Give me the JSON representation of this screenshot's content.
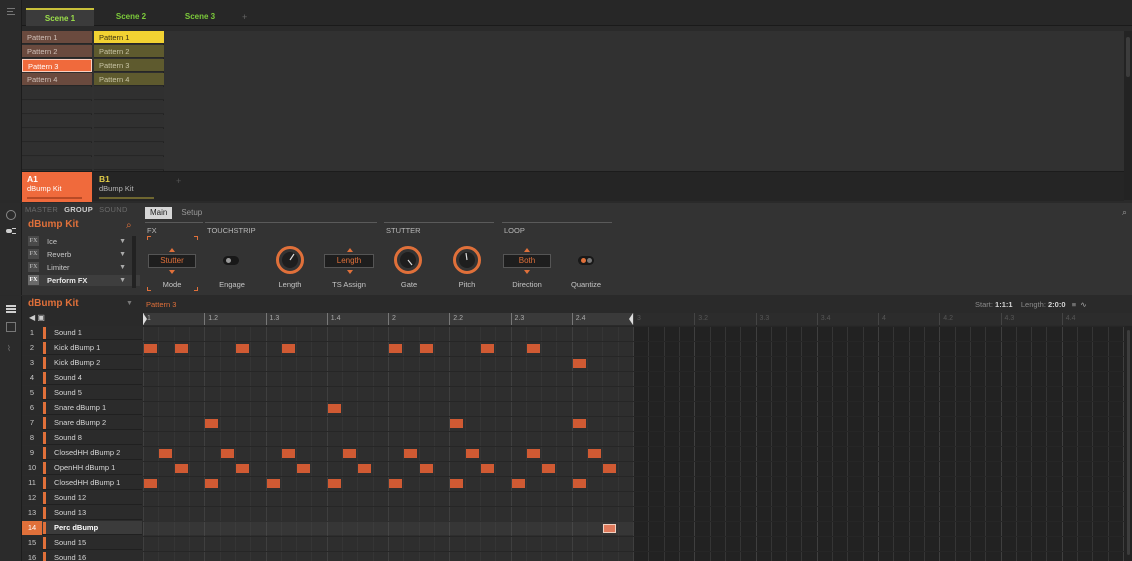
{
  "scenes": {
    "tabs": [
      "Scene 1",
      "Scene 2",
      "Scene 3"
    ],
    "add_label": "+"
  },
  "patterns": {
    "col_a": [
      "Pattern 1",
      "Pattern 2",
      "Pattern 3",
      "Pattern 4"
    ],
    "col_b": [
      "Pattern 1",
      "Pattern 2",
      "Pattern 3",
      "Pattern 4"
    ]
  },
  "groups": [
    {
      "letter": "A1",
      "kit": "dBump Kit"
    },
    {
      "letter": "B1",
      "kit": "dBump Kit"
    }
  ],
  "group_add": "+",
  "panel": {
    "tabs": [
      "MASTER",
      "GROUP",
      "SOUND"
    ],
    "kit_name": "dBump Kit",
    "fx_slots": [
      {
        "badge": "FX",
        "name": "Ice"
      },
      {
        "badge": "FX",
        "name": "Reverb"
      },
      {
        "badge": "FX",
        "name": "Limiter"
      },
      {
        "badge": "FX",
        "name": "Perform FX"
      }
    ],
    "main_tabs": [
      "Main",
      "Setup"
    ],
    "sections": [
      "FX",
      "TOUCHSTRIP",
      "STUTTER",
      "LOOP"
    ],
    "controls": {
      "mode": {
        "label": "Mode",
        "value": "Stutter"
      },
      "engage": {
        "label": "Engage"
      },
      "length": {
        "label": "Length"
      },
      "ts_assign": {
        "label": "TS Assign",
        "value": "Length"
      },
      "gate": {
        "label": "Gate"
      },
      "pitch": {
        "label": "Pitch"
      },
      "direction": {
        "label": "Direction",
        "value": "Both"
      },
      "quantize": {
        "label": "Quantize"
      }
    }
  },
  "editor": {
    "kit_name": "dBump Kit",
    "pattern_name": "Pattern 3",
    "start_label": "Start:",
    "start_value": "1:1:1",
    "length_label": "Length:",
    "length_value": "2:0:0",
    "ruler": [
      "1",
      "1.2",
      "1.3",
      "1.4",
      "2",
      "2.2",
      "2.3",
      "2.4",
      "3",
      "3.2",
      "3.3",
      "3.4",
      "4",
      "4.2",
      "4.3",
      "4.4"
    ],
    "sounds": [
      {
        "num": "1",
        "name": "Sound 1"
      },
      {
        "num": "2",
        "name": "Kick dBump 1"
      },
      {
        "num": "3",
        "name": "Kick dBump 2"
      },
      {
        "num": "4",
        "name": "Sound 4"
      },
      {
        "num": "5",
        "name": "Sound 5"
      },
      {
        "num": "6",
        "name": "Snare dBump 1"
      },
      {
        "num": "7",
        "name": "Snare dBump 2"
      },
      {
        "num": "8",
        "name": "Sound 8"
      },
      {
        "num": "9",
        "name": "ClosedHH dBump 2"
      },
      {
        "num": "10",
        "name": "OpenHH dBump 1"
      },
      {
        "num": "11",
        "name": "ClosedHH dBump 1"
      },
      {
        "num": "12",
        "name": "Sound 12"
      },
      {
        "num": "13",
        "name": "Sound 13"
      },
      {
        "num": "14",
        "name": "Perc dBump"
      },
      {
        "num": "15",
        "name": "Sound 15"
      },
      {
        "num": "16",
        "name": "Sound 16"
      }
    ],
    "selected_sound": 13,
    "notes": [
      {
        "row": 1,
        "steps": [
          0,
          2,
          6,
          9,
          16,
          18,
          22,
          25
        ]
      },
      {
        "row": 2,
        "steps": [
          28
        ]
      },
      {
        "row": 5,
        "steps": [
          12
        ]
      },
      {
        "row": 6,
        "steps": [
          4,
          20,
          28
        ]
      },
      {
        "row": 8,
        "steps": [
          1,
          5,
          9,
          13,
          17,
          21,
          25,
          29
        ]
      },
      {
        "row": 9,
        "steps": [
          2,
          6,
          10,
          14,
          18,
          22,
          26,
          30
        ]
      },
      {
        "row": 10,
        "steps": [
          0,
          4,
          8,
          12,
          16,
          20,
          24,
          28
        ]
      },
      {
        "row": 13,
        "steps": [
          30
        ],
        "selected": true
      }
    ]
  },
  "colors": {
    "accent": "#e0703a",
    "group_a": "#f06a3c",
    "group_b": "#c6b23a",
    "scene_text": "#7ccb3a"
  },
  "icons": {
    "search": "search-icon",
    "speaker": "speaker-icon",
    "menu": "menu-icon"
  }
}
